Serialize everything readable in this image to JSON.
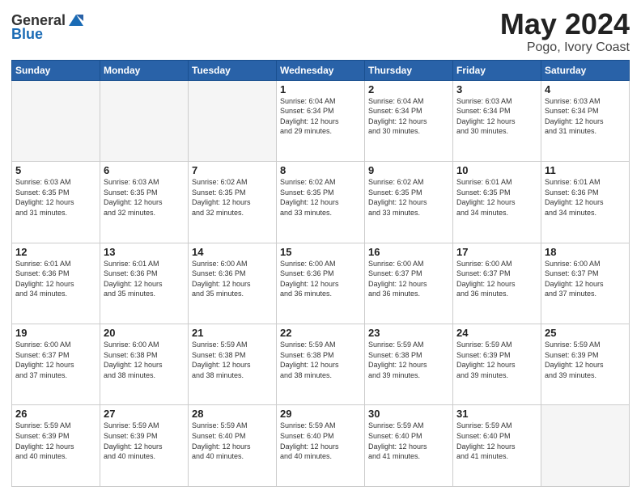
{
  "logo": {
    "general": "General",
    "blue": "Blue"
  },
  "title": "May 2024",
  "location": "Pogo, Ivory Coast",
  "days_of_week": [
    "Sunday",
    "Monday",
    "Tuesday",
    "Wednesday",
    "Thursday",
    "Friday",
    "Saturday"
  ],
  "weeks": [
    [
      {
        "num": "",
        "info": ""
      },
      {
        "num": "",
        "info": ""
      },
      {
        "num": "",
        "info": ""
      },
      {
        "num": "1",
        "info": "Sunrise: 6:04 AM\nSunset: 6:34 PM\nDaylight: 12 hours\nand 29 minutes."
      },
      {
        "num": "2",
        "info": "Sunrise: 6:04 AM\nSunset: 6:34 PM\nDaylight: 12 hours\nand 30 minutes."
      },
      {
        "num": "3",
        "info": "Sunrise: 6:03 AM\nSunset: 6:34 PM\nDaylight: 12 hours\nand 30 minutes."
      },
      {
        "num": "4",
        "info": "Sunrise: 6:03 AM\nSunset: 6:34 PM\nDaylight: 12 hours\nand 31 minutes."
      }
    ],
    [
      {
        "num": "5",
        "info": "Sunrise: 6:03 AM\nSunset: 6:35 PM\nDaylight: 12 hours\nand 31 minutes."
      },
      {
        "num": "6",
        "info": "Sunrise: 6:03 AM\nSunset: 6:35 PM\nDaylight: 12 hours\nand 32 minutes."
      },
      {
        "num": "7",
        "info": "Sunrise: 6:02 AM\nSunset: 6:35 PM\nDaylight: 12 hours\nand 32 minutes."
      },
      {
        "num": "8",
        "info": "Sunrise: 6:02 AM\nSunset: 6:35 PM\nDaylight: 12 hours\nand 33 minutes."
      },
      {
        "num": "9",
        "info": "Sunrise: 6:02 AM\nSunset: 6:35 PM\nDaylight: 12 hours\nand 33 minutes."
      },
      {
        "num": "10",
        "info": "Sunrise: 6:01 AM\nSunset: 6:35 PM\nDaylight: 12 hours\nand 34 minutes."
      },
      {
        "num": "11",
        "info": "Sunrise: 6:01 AM\nSunset: 6:36 PM\nDaylight: 12 hours\nand 34 minutes."
      }
    ],
    [
      {
        "num": "12",
        "info": "Sunrise: 6:01 AM\nSunset: 6:36 PM\nDaylight: 12 hours\nand 34 minutes."
      },
      {
        "num": "13",
        "info": "Sunrise: 6:01 AM\nSunset: 6:36 PM\nDaylight: 12 hours\nand 35 minutes."
      },
      {
        "num": "14",
        "info": "Sunrise: 6:00 AM\nSunset: 6:36 PM\nDaylight: 12 hours\nand 35 minutes."
      },
      {
        "num": "15",
        "info": "Sunrise: 6:00 AM\nSunset: 6:36 PM\nDaylight: 12 hours\nand 36 minutes."
      },
      {
        "num": "16",
        "info": "Sunrise: 6:00 AM\nSunset: 6:37 PM\nDaylight: 12 hours\nand 36 minutes."
      },
      {
        "num": "17",
        "info": "Sunrise: 6:00 AM\nSunset: 6:37 PM\nDaylight: 12 hours\nand 36 minutes."
      },
      {
        "num": "18",
        "info": "Sunrise: 6:00 AM\nSunset: 6:37 PM\nDaylight: 12 hours\nand 37 minutes."
      }
    ],
    [
      {
        "num": "19",
        "info": "Sunrise: 6:00 AM\nSunset: 6:37 PM\nDaylight: 12 hours\nand 37 minutes."
      },
      {
        "num": "20",
        "info": "Sunrise: 6:00 AM\nSunset: 6:38 PM\nDaylight: 12 hours\nand 38 minutes."
      },
      {
        "num": "21",
        "info": "Sunrise: 5:59 AM\nSunset: 6:38 PM\nDaylight: 12 hours\nand 38 minutes."
      },
      {
        "num": "22",
        "info": "Sunrise: 5:59 AM\nSunset: 6:38 PM\nDaylight: 12 hours\nand 38 minutes."
      },
      {
        "num": "23",
        "info": "Sunrise: 5:59 AM\nSunset: 6:38 PM\nDaylight: 12 hours\nand 39 minutes."
      },
      {
        "num": "24",
        "info": "Sunrise: 5:59 AM\nSunset: 6:39 PM\nDaylight: 12 hours\nand 39 minutes."
      },
      {
        "num": "25",
        "info": "Sunrise: 5:59 AM\nSunset: 6:39 PM\nDaylight: 12 hours\nand 39 minutes."
      }
    ],
    [
      {
        "num": "26",
        "info": "Sunrise: 5:59 AM\nSunset: 6:39 PM\nDaylight: 12 hours\nand 40 minutes."
      },
      {
        "num": "27",
        "info": "Sunrise: 5:59 AM\nSunset: 6:39 PM\nDaylight: 12 hours\nand 40 minutes."
      },
      {
        "num": "28",
        "info": "Sunrise: 5:59 AM\nSunset: 6:40 PM\nDaylight: 12 hours\nand 40 minutes."
      },
      {
        "num": "29",
        "info": "Sunrise: 5:59 AM\nSunset: 6:40 PM\nDaylight: 12 hours\nand 40 minutes."
      },
      {
        "num": "30",
        "info": "Sunrise: 5:59 AM\nSunset: 6:40 PM\nDaylight: 12 hours\nand 41 minutes."
      },
      {
        "num": "31",
        "info": "Sunrise: 5:59 AM\nSunset: 6:40 PM\nDaylight: 12 hours\nand 41 minutes."
      },
      {
        "num": "",
        "info": ""
      }
    ]
  ]
}
